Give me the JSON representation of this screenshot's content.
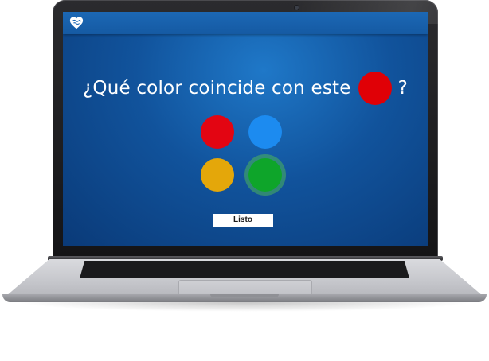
{
  "app": {
    "logo_icon": "brain-heart-logo-icon"
  },
  "question": {
    "text": "¿Qué color coincide con este",
    "end_mark": "?",
    "target_color": "#e00006"
  },
  "options": [
    {
      "name": "red",
      "color": "#e30512",
      "selected": false
    },
    {
      "name": "blue",
      "color": "#1c8bf0",
      "selected": false
    },
    {
      "name": "yellow",
      "color": "#e4a70a",
      "selected": false
    },
    {
      "name": "green",
      "color": "#0ea52a",
      "selected": true
    }
  ],
  "actions": {
    "done_label": "Listo"
  },
  "colors": {
    "screen_bg": "#11539c",
    "topbar_bg": "#1c68b5",
    "selection_ring": "#4db45a",
    "button_bg": "#ffffff"
  }
}
